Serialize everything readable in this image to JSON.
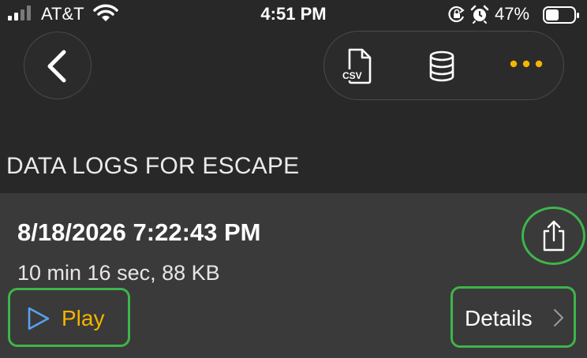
{
  "status_bar": {
    "carrier": "AT&T",
    "time": "4:51 PM",
    "battery_percent": "47%",
    "signal_bars_filled": 2,
    "signal_bars_total": 4,
    "battery_level": 0.47,
    "icons": [
      "signal-icon",
      "wifi-icon",
      "orientation-lock-icon",
      "alarm-icon",
      "battery-icon"
    ]
  },
  "nav": {
    "back_icon": "chevron-left-icon",
    "toolbar": {
      "csv_label": "CSV",
      "csv_icon": "csv-file-icon",
      "database_icon": "database-icon",
      "more_icon": "more-dots-icon"
    }
  },
  "page": {
    "title": "DATA LOGS FOR ESCAPE"
  },
  "log_entry": {
    "datetime": "8/18/2026 7:22:43 PM",
    "meta": "10 min 16 sec, 88 KB",
    "share_icon": "share-icon",
    "play_label": "Play",
    "play_icon": "play-icon",
    "details_label": "Details",
    "details_icon": "chevron-right-icon"
  },
  "colors": {
    "background": "#282828",
    "card": "#3a3a3a",
    "accent": "#f4b400",
    "highlight": "#3eb54a",
    "play_icon": "#5aa0f0"
  }
}
